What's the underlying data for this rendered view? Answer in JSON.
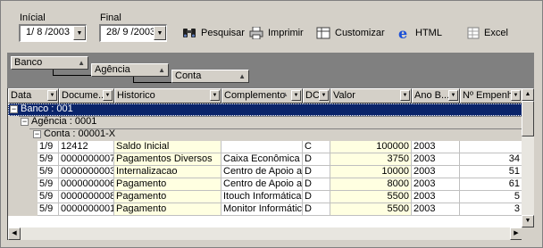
{
  "filters": {
    "inicial_label": "Inícial",
    "final_label": "Final",
    "inicial_value": "1/ 8 /2003",
    "final_value": "28/ 9 /2003"
  },
  "toolbar": {
    "pesquisar": "Pesquisar",
    "imprimir": "Imprimir",
    "customizar": "Customizar",
    "html": "HTML",
    "excel": "Excel"
  },
  "grouping": {
    "level1": "Banco",
    "level2": "Agência",
    "level3": "Conta"
  },
  "columns": [
    "Data",
    "Docume...",
    "Historico",
    "Complemento",
    "DC",
    "Valor",
    "Ano B...",
    "Nº Empenho"
  ],
  "groups": {
    "banco": "Banco : 001",
    "agencia": "Agência : 0001",
    "conta": "Conta : 00001-X"
  },
  "rows": [
    {
      "data": "1/9",
      "doc": "12412",
      "hist": "Saldo Inicial",
      "comp": "",
      "dc": "C",
      "valor": "100000",
      "ano": "2003",
      "emp": ""
    },
    {
      "data": "5/9",
      "doc": "0000000007",
      "hist": "Pagamentos Diversos",
      "comp": "Caixa Econômica Fed",
      "dc": "D",
      "valor": "3750",
      "ano": "2003",
      "emp": "34"
    },
    {
      "data": "5/9",
      "doc": "0000000003",
      "hist": "Internalizacao",
      "comp": "Centro de Apoio ao D",
      "dc": "D",
      "valor": "10000",
      "ano": "2003",
      "emp": "51"
    },
    {
      "data": "5/9",
      "doc": "0000000006",
      "hist": "Pagamento",
      "comp": "Centro de Apoio ao D",
      "dc": "D",
      "valor": "8000",
      "ano": "2003",
      "emp": "61"
    },
    {
      "data": "5/9",
      "doc": "0000000008",
      "hist": "Pagamento",
      "comp": "Itouch Informática Ltd",
      "dc": "D",
      "valor": "5500",
      "ano": "2003",
      "emp": "5"
    },
    {
      "data": "5/9",
      "doc": "0000000001",
      "hist": "Pagamento",
      "comp": "Monitor Informática Ltd",
      "dc": "D",
      "valor": "5500",
      "ano": "2003",
      "emp": "3"
    }
  ],
  "colors": {
    "group_banco_bg": "#0a246a",
    "row_yellow": "#ffffe1",
    "face": "#d4d0c8",
    "grouparea": "#808080"
  }
}
